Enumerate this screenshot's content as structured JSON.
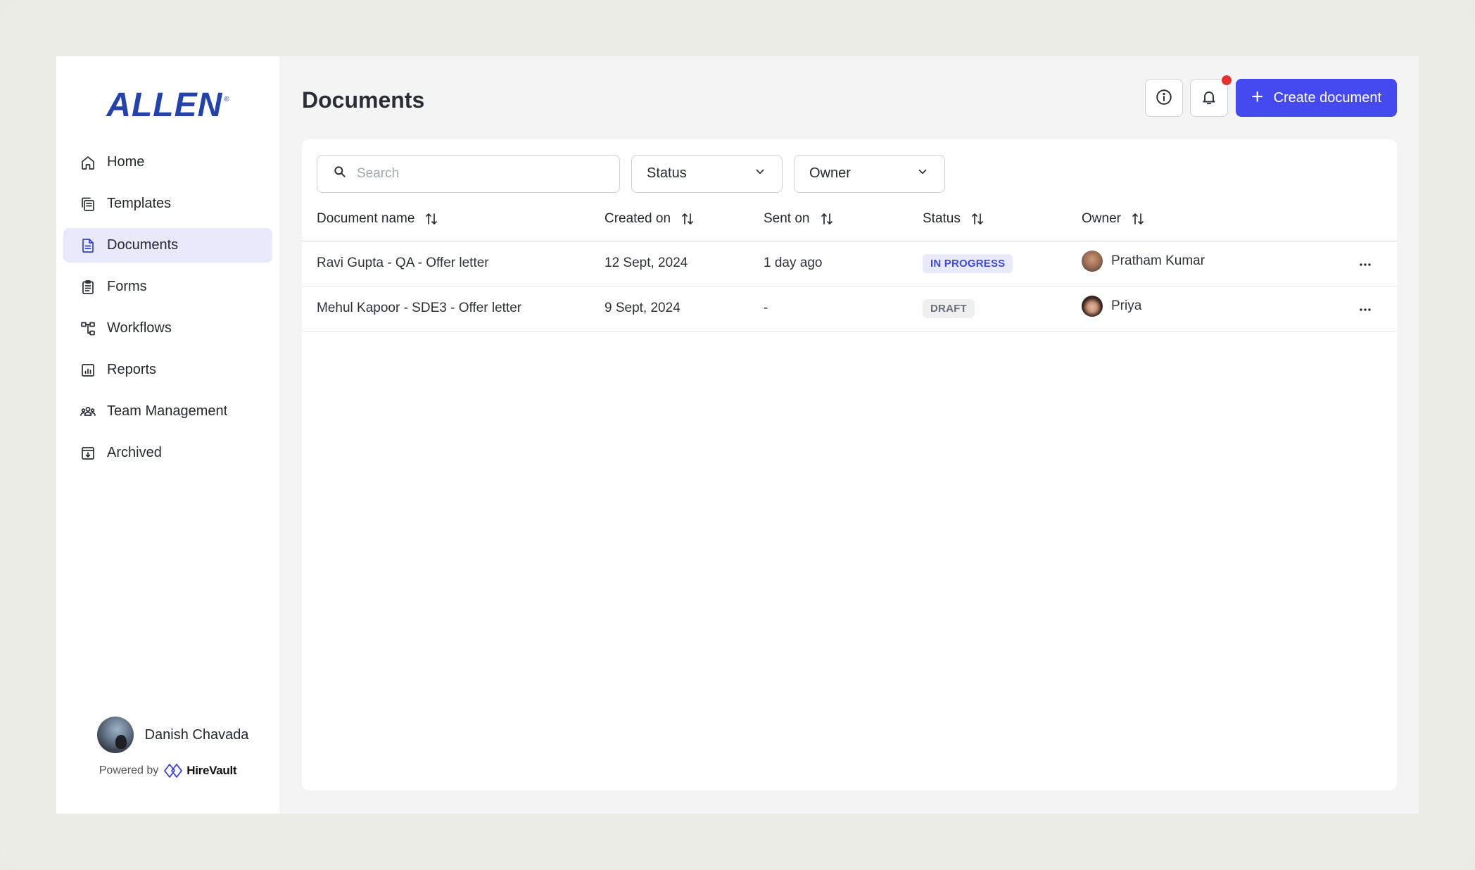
{
  "brand": {
    "logo_text": "ALLEN",
    "logo_mark": "®"
  },
  "sidebar": {
    "items": [
      {
        "label": "Home",
        "icon": "home-icon"
      },
      {
        "label": "Templates",
        "icon": "templates-icon"
      },
      {
        "label": "Documents",
        "icon": "document-icon",
        "active": true
      },
      {
        "label": "Forms",
        "icon": "clipboard-icon"
      },
      {
        "label": "Workflows",
        "icon": "workflow-icon"
      },
      {
        "label": "Reports",
        "icon": "reports-icon"
      },
      {
        "label": "Team Management",
        "icon": "team-icon"
      },
      {
        "label": "Archived",
        "icon": "archive-icon"
      }
    ],
    "user": {
      "name": "Danish Chavada"
    },
    "powered_by": {
      "prefix": "Powered by",
      "name": "HireVault"
    }
  },
  "header": {
    "title": "Documents",
    "create_button": "Create document",
    "info_icon": "info-icon",
    "bell_icon": "bell-icon"
  },
  "filters": {
    "search_placeholder": "Search",
    "status_label": "Status",
    "owner_label": "Owner"
  },
  "table": {
    "columns": [
      "Document name",
      "Created on",
      "Sent on",
      "Status",
      "Owner"
    ],
    "rows": [
      {
        "name": "Ravi Gupta - QA - Offer letter",
        "created": "12 Sept, 2024",
        "sent": "1 day ago",
        "status": "IN PROGRESS",
        "owner": "Pratham Kumar"
      },
      {
        "name": "Mehul Kapoor - SDE3 - Offer letter",
        "created": "9 Sept, 2024",
        "sent": "-",
        "status": "DRAFT",
        "owner": "Priya"
      }
    ]
  },
  "colors": {
    "accent": "#4549f0",
    "active_nav_bg": "#e8eafb",
    "notification_dot": "#e3322f",
    "brand_blue": "#2442a8"
  }
}
